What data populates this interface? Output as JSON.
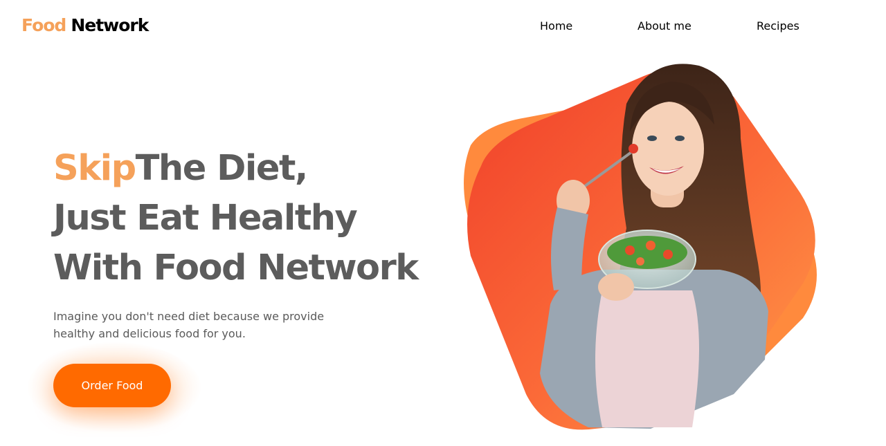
{
  "header": {
    "logo_accent": "Food",
    "logo_main": "Network",
    "nav": [
      {
        "label": "Home"
      },
      {
        "label": "About me"
      },
      {
        "label": "Recipes"
      }
    ]
  },
  "hero": {
    "headline_accent": "Skip",
    "headline_line1": "The Diet,",
    "headline_line2": "Just Eat Healthy",
    "headline_line3": "With Food Network",
    "description": "Imagine you don't need diet because we provide healthy and delicious food for you.",
    "cta_label": "Order Food",
    "image_alt": "woman-eating-salad-illustration"
  },
  "colors": {
    "accent": "#f5a15a",
    "cta": "#ff6a00",
    "headline": "#5c5c5c",
    "blob_light": "#ff9a4a",
    "blob_dark": "#f24a2c"
  }
}
